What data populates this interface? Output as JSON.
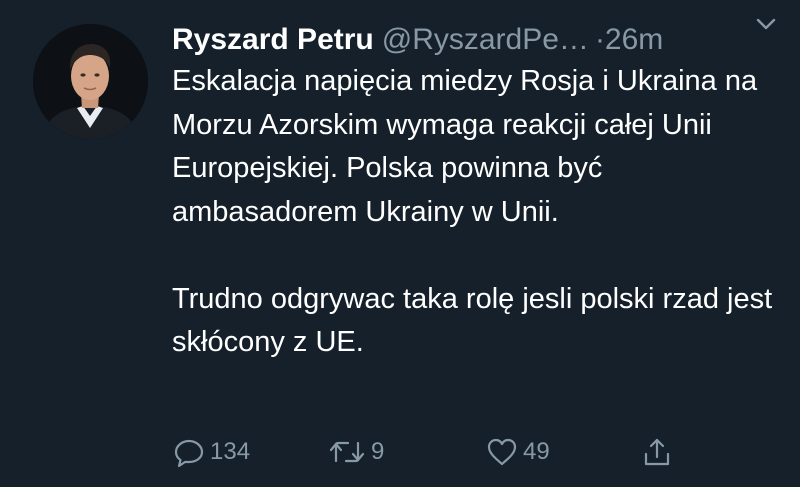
{
  "tweet": {
    "author_name": "Ryszard Petru",
    "author_handle": "@RyszardPe…",
    "time": "·26m",
    "paragraphs": [
      "Eskalacja napięcia miedzy Rosja i Ukraina na Morzu Azorskim wymaga reakcji całej Unii Europejskiej. Polska powinna być ambasadorem Ukrainy w Unii.",
      "Trudno odgrywac taka rolę jesli polski rzad jest skłócony z UE."
    ],
    "actions": {
      "replies": "134",
      "retweets": "9",
      "likes": "49"
    },
    "icons": {
      "reply": "speech-bubble-icon",
      "retweet": "retweet-arrows-icon",
      "like": "heart-icon",
      "share": "share-upload-icon",
      "menu": "chevron-down-icon"
    }
  },
  "colors": {
    "background": "#15202b",
    "text": "#ffffff",
    "muted": "#8899a6"
  }
}
